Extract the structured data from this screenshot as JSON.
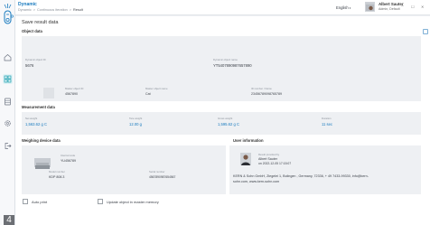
{
  "app": {
    "title": "Dynamic"
  },
  "breadcrumb": [
    "Dynamic",
    "Continuous iteration",
    "Result"
  ],
  "header": {
    "language": "English",
    "user_name": "Albert Sauter",
    "user_role": "Admin, Default",
    "minimize": "–",
    "maximize": "☐",
    "close": "✕"
  },
  "page": {
    "title": "Save result data"
  },
  "object_data": {
    "heading": "Object data",
    "id_label": "Dynamic object ID",
    "id_value": "5676",
    "name_label": "Dynamic object name",
    "name_value": "YT5407890987657890",
    "master_id_label": "Master object ID",
    "master_id_value": "4567890",
    "master_name_label": "Master object name",
    "master_name_value": "Cat",
    "number_label": "ID number / Name",
    "number_value": "23456789098765789"
  },
  "measurement": {
    "heading": "Measurement data",
    "net_label": "Net weight",
    "net_value": "1,563.62 g C",
    "tare_label": "Tare weight",
    "tare_value": "12.00 g",
    "gross_label": "Gross weight",
    "gross_value": "1,595.62 g C",
    "duration_label": "Duration",
    "duration_value": "11 sec"
  },
  "weighing_device": {
    "heading": "Weighing device data",
    "internal_label": "Internal code",
    "internal_value": "YU456789",
    "model_label": "Model number",
    "model_value": "KDP 808.3",
    "serial_label": "Serial number",
    "serial_value": "4567890987654567"
  },
  "user_info": {
    "heading": "User information",
    "provided_label": "Result provided by",
    "provided_name": "Albert Sauter",
    "provided_date": "on 2022-12-05 17:15:07",
    "company_line1": "KERN & Sohn GmbH, Ziegelei 1, Bolingen , Germany, 72336, + 49 7433-99330, info@kern-",
    "company_line2": "sohn.com, www.kern-sohn.com"
  },
  "options": {
    "auto_print": "Auto print",
    "update_master": "Update object in master memory"
  },
  "badge": {
    "number": "4"
  },
  "colors": {
    "accent": "#1a7bbf",
    "panel": "#eef0f3",
    "sidebar_active": "#e3f3f6"
  }
}
